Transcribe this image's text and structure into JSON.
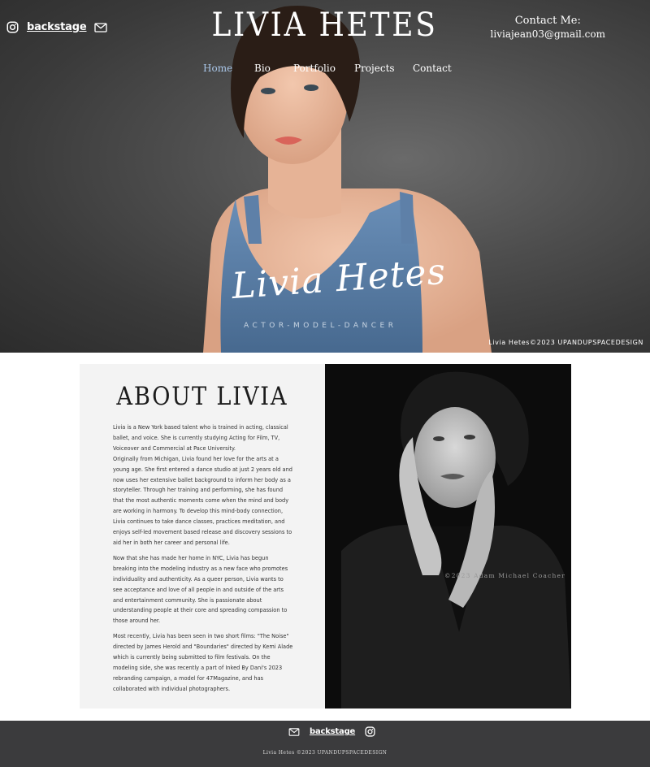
{
  "header": {
    "site_title": "LIVIA HETES",
    "contact_label": "Contact Me:",
    "contact_email": "liviajean03@gmail.com",
    "social": {
      "backstage_label": "backstage"
    }
  },
  "nav": {
    "items": [
      {
        "label": "Home",
        "active": true
      },
      {
        "label": "Bio"
      },
      {
        "label": "Portfolio"
      },
      {
        "label": "Projects"
      },
      {
        "label": "Contact"
      }
    ]
  },
  "hero": {
    "signature": "Livia Hetes",
    "tagline": "ACTOR-MODEL-DANCER",
    "credit": "Livia Hetes©2023 UPANDUPSPACEDESIGN"
  },
  "about": {
    "title": "ABOUT LIVIA",
    "paragraphs": [
      "Livia is a New York based talent who is trained in acting, classical ballet, and voice. She is currently studying Acting for Film, TV, Voiceover and Commercial at Pace University.",
      "Originally from Michigan, Livia found her love for the arts at a young age. She first entered a dance studio at just 2 years old and now uses her extensive ballet background to inform her body as a storyteller. Through her training and performing, she has found that the most authentic moments come when the mind and body are working in harmony. To develop this mind-body connection, Livia continues to take dance classes, practices meditation, and enjoys self-led movement based release and discovery sessions to aid her in both her career and personal life.",
      "Now that she has made her home in NYC, Livia has begun breaking into the modeling industry as a new face who promotes individuality and authenticity. As a queer person, Livia wants to see acceptance and love of all people in and outside of the arts and entertainment community. She is passionate about understanding people at their core and spreading compassion to those around her.",
      "Most recently, Livia has been seen in two short films: \"The Noise\" directed by James Herold and \"Boundaries\" directed by Kemi Alade which is currently being submitted to film festivals. On the modeling side, she was recently a part of Inked By Dani's 2023 rebranding campaign, a model for 47Magazine, and has collaborated with individual photographers."
    ],
    "photo_credit": "©2023 Adam Michael Coacher"
  },
  "footer": {
    "backstage_label": "backstage",
    "copyright": "Livia Hetes ©2023 UPANDUPSPACEDESIGN"
  },
  "colors": {
    "nav_active": "#a9c6e8",
    "footer_bg": "#3b3b3d",
    "about_bg": "#f3f3f3",
    "tank_top": "#5b7fa6"
  }
}
